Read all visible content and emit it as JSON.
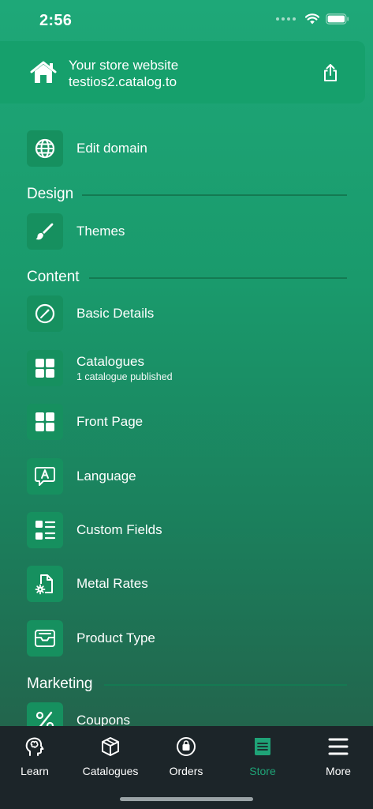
{
  "status_bar": {
    "time": "2:56"
  },
  "store": {
    "label": "Your store website",
    "url": "testios2.catalog.to"
  },
  "items": {
    "edit_domain": {
      "title": "Edit domain",
      "icon": "globe-icon"
    },
    "themes": {
      "title": "Themes",
      "icon": "brush-icon"
    },
    "basic_details": {
      "title": "Basic Details",
      "icon": "compass-icon"
    },
    "catalogues": {
      "title": "Catalogues",
      "subtitle": "1 catalogue published",
      "icon": "grid-icon"
    },
    "front_page": {
      "title": "Front Page",
      "icon": "grid-icon"
    },
    "language": {
      "title": "Language",
      "icon": "language-icon"
    },
    "custom_fields": {
      "title": "Custom Fields",
      "icon": "list-icon"
    },
    "metal_rates": {
      "title": "Metal Rates",
      "icon": "file-gear-icon"
    },
    "product_type": {
      "title": "Product Type",
      "icon": "tray-icon"
    },
    "coupons": {
      "title": "Coupons",
      "icon": "percent-icon"
    }
  },
  "sections": {
    "design": "Design",
    "content": "Content",
    "marketing": "Marketing"
  },
  "tabs": [
    {
      "label": "Learn",
      "icon": "brain-icon"
    },
    {
      "label": "Catalogues",
      "icon": "box-icon"
    },
    {
      "label": "Orders",
      "icon": "bag-icon"
    },
    {
      "label": "Store",
      "icon": "store-icon",
      "active": true
    },
    {
      "label": "More",
      "icon": "menu-icon"
    }
  ],
  "colors": {
    "accent": "#1fa377",
    "tile": "#16905f",
    "tab_bar": "#1c2529"
  }
}
